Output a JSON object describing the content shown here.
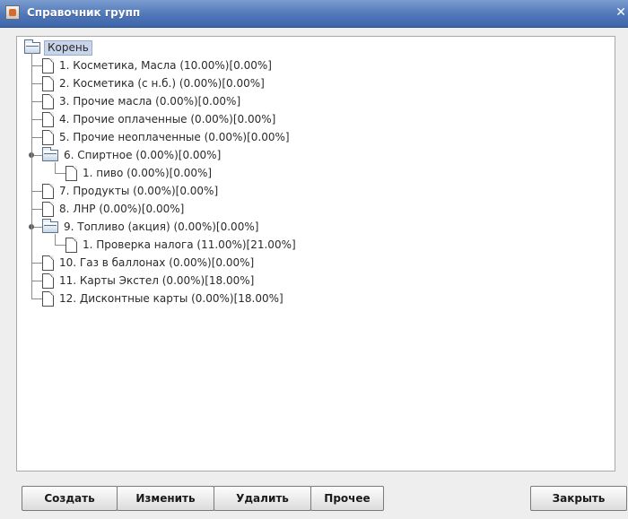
{
  "window": {
    "title": "Справочник групп",
    "close_icon": "close-icon"
  },
  "tree": {
    "root": "Корень",
    "items": [
      {
        "label": "1. Косметика, Масла (10.00%)[0.00%]",
        "type": "leaf",
        "level": 1
      },
      {
        "label": "2. Косметика (с н.б.) (0.00%)[0.00%]",
        "type": "leaf",
        "level": 1
      },
      {
        "label": "3. Прочие масла (0.00%)[0.00%]",
        "type": "leaf",
        "level": 1
      },
      {
        "label": "4. Прочие оплаченные (0.00%)[0.00%]",
        "type": "leaf",
        "level": 1
      },
      {
        "label": "5. Прочие неоплаченные (0.00%)[0.00%]",
        "type": "leaf",
        "level": 1
      },
      {
        "label": "6. Спиртное (0.00%)[0.00%]",
        "type": "folder",
        "level": 1,
        "expanded": true
      },
      {
        "label": "1. пиво (0.00%)[0.00%]",
        "type": "leaf",
        "level": 2
      },
      {
        "label": "7. Продукты (0.00%)[0.00%]",
        "type": "leaf",
        "level": 1
      },
      {
        "label": "8. ЛНР (0.00%)[0.00%]",
        "type": "leaf",
        "level": 1
      },
      {
        "label": "9. Топливо (акция) (0.00%)[0.00%]",
        "type": "folder",
        "level": 1,
        "expanded": true
      },
      {
        "label": "1. Проверка налога (11.00%)[21.00%]",
        "type": "leaf",
        "level": 2
      },
      {
        "label": "10. Газ в баллонах (0.00%)[0.00%]",
        "type": "leaf",
        "level": 1
      },
      {
        "label": "11. Карты Экстел (0.00%)[18.00%]",
        "type": "leaf",
        "level": 1
      },
      {
        "label": "12. Дисконтные карты (0.00%)[18.00%]",
        "type": "leaf",
        "level": 1
      }
    ]
  },
  "buttons": {
    "create": "Создать",
    "edit": "Изменить",
    "delete": "Удалить",
    "other": "Прочее",
    "close": "Закрыть"
  }
}
